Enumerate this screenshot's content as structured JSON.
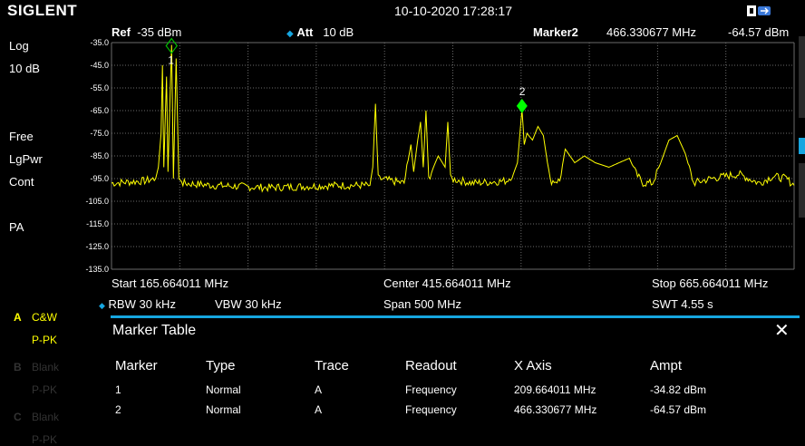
{
  "titlebar": {
    "brand": "SIGLENT",
    "datetime": "10-10-2020 17:28:17",
    "icons": [
      "connection-icon",
      "usb-icon"
    ]
  },
  "left_panel": {
    "scale_type": "Log",
    "scale_div": "10 dB",
    "trig": "Free",
    "detect": "LgPwr",
    "sweep_mode": "Cont",
    "preamp": "PA"
  },
  "header": {
    "ref_label": "Ref",
    "ref_value": "-35 dBm",
    "att_label": "Att",
    "att_value": "10 dB",
    "marker_label": "Marker2",
    "marker_freq": "466.330677 MHz",
    "marker_ampt": "-64.57 dBm"
  },
  "axis": {
    "y_ticks": [
      "-35.0",
      "-45.0",
      "-55.0",
      "-65.0",
      "-75.0",
      "-85.0",
      "-95.0",
      "-105.0",
      "-115.0",
      "-125.0",
      "-135.0"
    ]
  },
  "footer": {
    "start": "Start  165.664011 MHz",
    "center": "Center  415.664011 MHz",
    "stop": "Stop  665.664011 MHz",
    "rbw": "RBW  30 kHz",
    "vbw": "VBW  30 kHz",
    "span": "Span   500 MHz",
    "swt": "SWT  4.55 s"
  },
  "traces": [
    {
      "letter": "A",
      "mode": "C&W",
      "mode2": "P-PK",
      "color": "#ffff00"
    },
    {
      "letter": "B",
      "mode": "Blank",
      "mode2": "P-PK",
      "color": "#333333"
    },
    {
      "letter": "C",
      "mode": "Blank",
      "mode2": "P-PK",
      "color": "#333333"
    }
  ],
  "marker_table": {
    "title": "Marker Table",
    "close_glyph": "✕",
    "columns": [
      "Marker",
      "Type",
      "Trace",
      "Readout",
      "X Axis",
      "Ampt"
    ],
    "rows": [
      [
        "1",
        "Normal",
        "A",
        "Frequency",
        "209.664011 MHz",
        "-34.82 dBm"
      ],
      [
        "2",
        "Normal",
        "A",
        "Frequency",
        "466.330677 MHz",
        "-64.57 dBm"
      ]
    ]
  },
  "colors": {
    "trace": "#ffff00",
    "marker1": "#00c000",
    "marker2": "#00ff00",
    "accent": "#16a6e0",
    "grid": "#6a6a6a"
  },
  "chart_data": {
    "type": "line",
    "x_unit": "MHz",
    "y_unit": "dBm",
    "xlim": [
      165.664011,
      665.664011
    ],
    "ylim": [
      -135,
      -35
    ],
    "grid": true,
    "segments": [
      [
        165.66,
        -97
      ],
      [
        190,
        -96
      ],
      [
        198,
        -95
      ],
      [
        200,
        -90
      ],
      [
        202,
        -75
      ],
      [
        203,
        -45
      ],
      [
        204,
        -90
      ],
      [
        206,
        -50
      ],
      [
        207,
        -92
      ],
      [
        209.66,
        -36
      ],
      [
        211,
        -95
      ],
      [
        213,
        -42
      ],
      [
        215,
        -95
      ],
      [
        218,
        -97
      ],
      [
        240,
        -98
      ],
      [
        280,
        -99
      ],
      [
        330,
        -98
      ],
      [
        355,
        -98
      ],
      [
        357,
        -90
      ],
      [
        359,
        -62
      ],
      [
        361,
        -95
      ],
      [
        380,
        -97
      ],
      [
        385,
        -80
      ],
      [
        387,
        -92
      ],
      [
        390,
        -78
      ],
      [
        392,
        -70
      ],
      [
        394,
        -90
      ],
      [
        396,
        -65
      ],
      [
        398,
        -95
      ],
      [
        405,
        -85
      ],
      [
        410,
        -90
      ],
      [
        412,
        -70
      ],
      [
        414,
        -95
      ],
      [
        430,
        -97
      ],
      [
        455,
        -96
      ],
      [
        460,
        -93
      ],
      [
        463,
        -88
      ],
      [
        466.33,
        -64.6
      ],
      [
        468,
        -80
      ],
      [
        470,
        -75
      ],
      [
        474,
        -78
      ],
      [
        478,
        -72
      ],
      [
        482,
        -76
      ],
      [
        487,
        -96
      ],
      [
        494,
        -96
      ],
      [
        498,
        -82
      ],
      [
        505,
        -88
      ],
      [
        512,
        -85
      ],
      [
        520,
        -88
      ],
      [
        530,
        -90
      ],
      [
        545,
        -86
      ],
      [
        550,
        -93
      ],
      [
        555,
        -97
      ],
      [
        562,
        -97
      ],
      [
        568,
        -88
      ],
      [
        574,
        -78
      ],
      [
        580,
        -76
      ],
      [
        586,
        -84
      ],
      [
        592,
        -97
      ],
      [
        605,
        -95
      ],
      [
        625,
        -93
      ],
      [
        640,
        -97
      ],
      [
        650,
        -94
      ],
      [
        660,
        -95
      ],
      [
        665.66,
        -98
      ]
    ],
    "markers": [
      {
        "id": "1",
        "x": 209.664011,
        "y": -34.82
      },
      {
        "id": "2",
        "x": 466.330677,
        "y": -64.57
      }
    ]
  }
}
